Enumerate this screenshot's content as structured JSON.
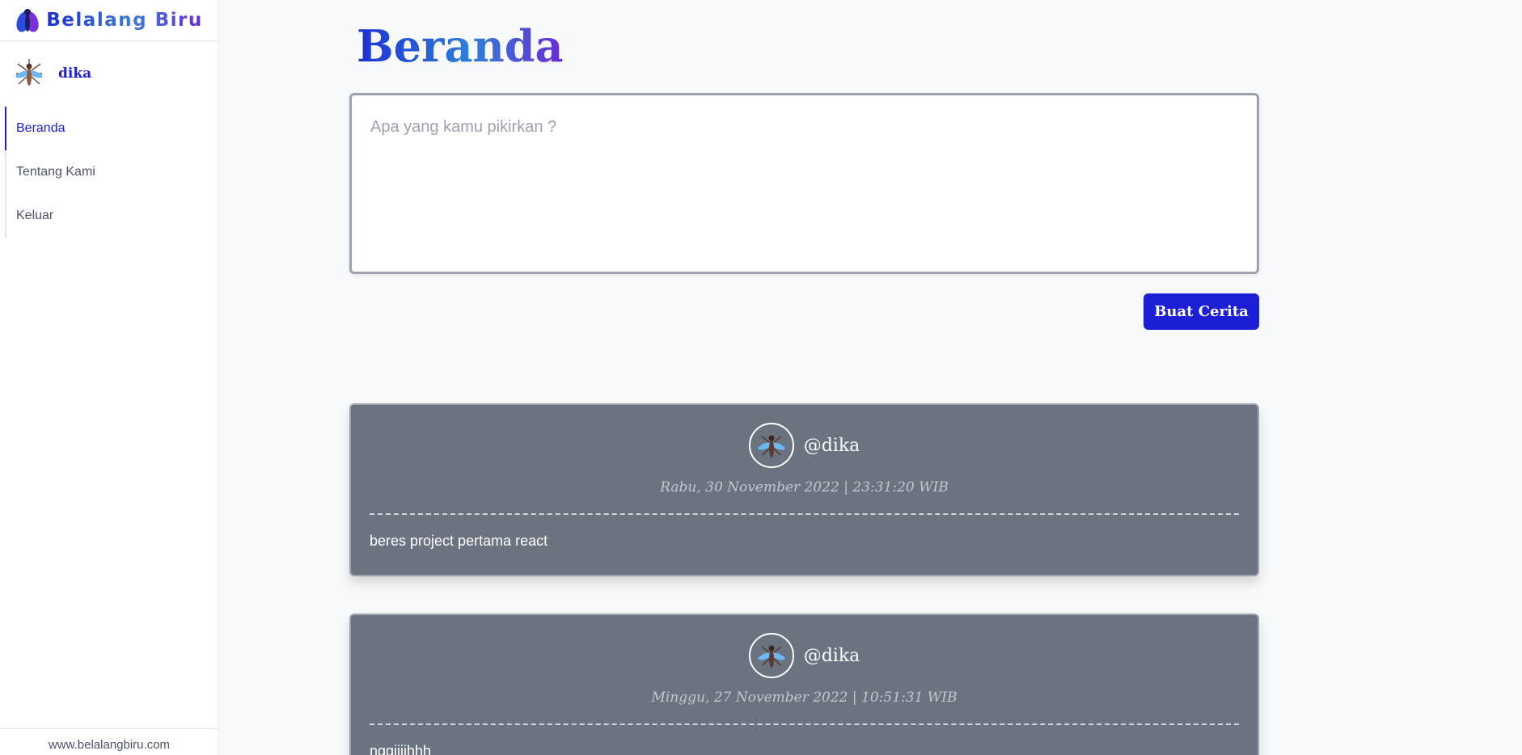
{
  "brand": {
    "name": "Belalang Biru",
    "logo_icon": "mosquito-logo-icon"
  },
  "user": {
    "name": "dika",
    "avatar_icon": "mosquito-avatar-icon"
  },
  "nav": {
    "items": [
      {
        "label": "Beranda",
        "active": true
      },
      {
        "label": "Tentang Kami",
        "active": false
      },
      {
        "label": "Keluar",
        "active": false
      }
    ]
  },
  "footer": {
    "text": "www.belalangbiru.com"
  },
  "page": {
    "title": "Beranda"
  },
  "composer": {
    "placeholder": "Apa yang kamu pikirkan ?",
    "value": ""
  },
  "submit": {
    "label": "Buat Cerita"
  },
  "posts": [
    {
      "user": "@dika",
      "date": "Rabu, 30 November 2022 | 23:31:20 WIB",
      "content": "beres project pertama react"
    },
    {
      "user": "@dika",
      "date": "Minggu, 27 November 2022 | 10:51:31 WIB",
      "content": "nggiiiihhh"
    }
  ],
  "colors": {
    "accent": "#1d1fd6",
    "card": "#6b7280",
    "background": "#f8f9fb"
  }
}
